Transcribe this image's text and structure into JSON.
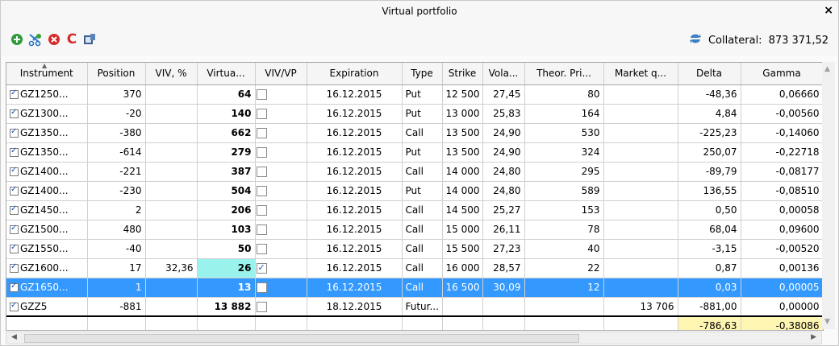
{
  "window": {
    "title": "Virtual portfolio",
    "close_glyph": "×"
  },
  "toolbar": {
    "icons": [
      "add-icon",
      "scissors-icon",
      "delete-icon",
      "clear-icon",
      "export-icon"
    ],
    "collateral_label": "Collateral:",
    "collateral_value": "873 371,52"
  },
  "columns": [
    "Instrument",
    "Position",
    "VIV, %",
    "Virtua...",
    "VIV/VP",
    "Expiration",
    "Type",
    "Strike",
    "Vola...",
    "Theor. Pri...",
    "Market q...",
    "Delta",
    "Gamma"
  ],
  "rows": [
    {
      "instrument": "GZ1250...",
      "checked": true,
      "position": "370",
      "viv": "",
      "virtual": "64",
      "vivvp": false,
      "expiration": "16.12.2015",
      "type": "Put",
      "strike": "12 500",
      "vola": "27,45",
      "theor": "80",
      "market": "",
      "delta": "-48,36",
      "gamma": "0,06660"
    },
    {
      "instrument": "GZ1300...",
      "checked": true,
      "position": "-20",
      "viv": "",
      "virtual": "140",
      "vivvp": false,
      "expiration": "16.12.2015",
      "type": "Put",
      "strike": "13 000",
      "vola": "25,83",
      "theor": "164",
      "market": "",
      "delta": "4,84",
      "gamma": "-0,00560"
    },
    {
      "instrument": "GZ1350...",
      "checked": true,
      "position": "-380",
      "viv": "",
      "virtual": "662",
      "vivvp": false,
      "expiration": "16.12.2015",
      "type": "Call",
      "strike": "13 500",
      "vola": "24,90",
      "theor": "530",
      "market": "",
      "delta": "-225,23",
      "gamma": "-0,14060"
    },
    {
      "instrument": "GZ1350...",
      "checked": true,
      "position": "-614",
      "viv": "",
      "virtual": "279",
      "vivvp": false,
      "expiration": "16.12.2015",
      "type": "Put",
      "strike": "13 500",
      "vola": "24,90",
      "theor": "324",
      "market": "",
      "delta": "250,07",
      "gamma": "-0,22718"
    },
    {
      "instrument": "GZ1400...",
      "checked": true,
      "position": "-221",
      "viv": "",
      "virtual": "387",
      "vivvp": false,
      "expiration": "16.12.2015",
      "type": "Call",
      "strike": "14 000",
      "vola": "24,80",
      "theor": "295",
      "market": "",
      "delta": "-89,79",
      "gamma": "-0,08177"
    },
    {
      "instrument": "GZ1400...",
      "checked": true,
      "position": "-230",
      "viv": "",
      "virtual": "504",
      "vivvp": false,
      "expiration": "16.12.2015",
      "type": "Put",
      "strike": "14 000",
      "vola": "24,80",
      "theor": "589",
      "market": "",
      "delta": "136,55",
      "gamma": "-0,08510"
    },
    {
      "instrument": "GZ1450...",
      "checked": true,
      "position": "2",
      "viv": "",
      "virtual": "206",
      "vivvp": false,
      "expiration": "16.12.2015",
      "type": "Call",
      "strike": "14 500",
      "vola": "25,27",
      "theor": "153",
      "market": "",
      "delta": "0,50",
      "gamma": "0,00058"
    },
    {
      "instrument": "GZ1500...",
      "checked": true,
      "position": "480",
      "viv": "",
      "virtual": "103",
      "vivvp": false,
      "expiration": "16.12.2015",
      "type": "Call",
      "strike": "15 000",
      "vola": "26,11",
      "theor": "78",
      "market": "",
      "delta": "68,04",
      "gamma": "0,09600"
    },
    {
      "instrument": "GZ1550...",
      "checked": true,
      "position": "-40",
      "viv": "",
      "virtual": "50",
      "vivvp": false,
      "expiration": "16.12.2015",
      "type": "Call",
      "strike": "15 500",
      "vola": "27,23",
      "theor": "40",
      "market": "",
      "delta": "-3,15",
      "gamma": "-0,00520"
    },
    {
      "instrument": "GZ1600...",
      "checked": true,
      "position": "17",
      "viv": "32,36",
      "virtual": "26",
      "vivvp": true,
      "expiration": "16.12.2015",
      "type": "Call",
      "strike": "16 000",
      "vola": "28,57",
      "theor": "22",
      "market": "",
      "delta": "0,87",
      "gamma": "0,00136",
      "highlight_virtual": true
    },
    {
      "instrument": "GZ1650...",
      "checked": true,
      "position": "1",
      "viv": "",
      "virtual": "13",
      "vivvp": false,
      "expiration": "16.12.2015",
      "type": "Call",
      "strike": "16 500",
      "vola": "30,09",
      "theor": "12",
      "market": "",
      "delta": "0,03",
      "gamma": "0,00005",
      "selected": true
    },
    {
      "instrument": "GZZ5",
      "checked": true,
      "position": "-881",
      "viv": "",
      "virtual": "13 882",
      "vivvp": false,
      "expiration": "18.12.2015",
      "type": "Futur...",
      "strike": "",
      "vola": "",
      "theor": "",
      "market": "13 706",
      "delta": "-881,00",
      "gamma": "0,00000"
    }
  ],
  "totals": {
    "delta": "-786,63",
    "gamma": "-0,38086"
  },
  "colors": {
    "selection": "#3399ff",
    "highlight_cyan": "#99f2ec",
    "totals_yellow": "#fff5b3"
  }
}
